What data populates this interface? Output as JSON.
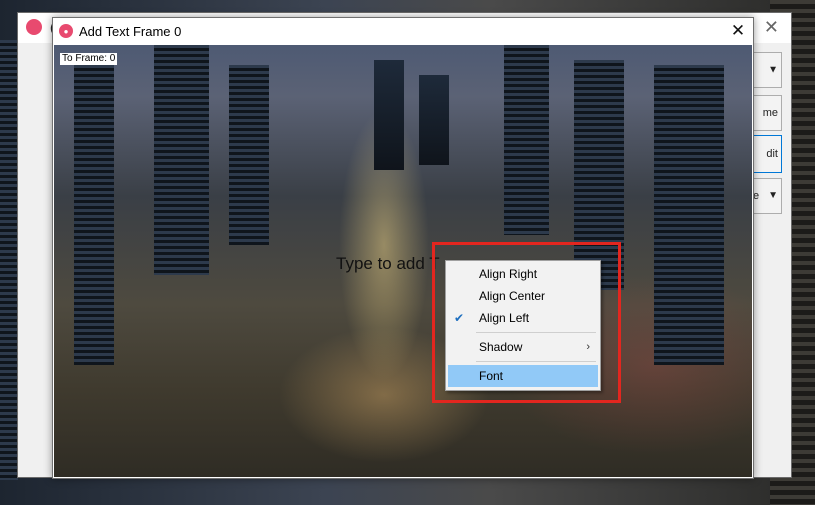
{
  "background_window": {
    "title": "(",
    "side_controls": [
      {
        "label": "",
        "type": "dropdown"
      },
      {
        "label": "me",
        "type": "button"
      },
      {
        "label": "dit",
        "type": "button"
      },
      {
        "label": "e",
        "type": "dropdown"
      }
    ]
  },
  "dialog": {
    "title": "Add Text Frame 0",
    "close_label": "✕",
    "frame_label": "To Frame: 0",
    "overlay_text": "Type to add T"
  },
  "context_menu": {
    "items": [
      {
        "label": "Align Right",
        "checked": false
      },
      {
        "label": "Align Center",
        "checked": false
      },
      {
        "label": "Align Left",
        "checked": true
      },
      {
        "label": "Shadow",
        "submenu": true
      },
      {
        "label": "Font",
        "selected": true
      }
    ]
  },
  "colors": {
    "highlight_border": "#e3261f",
    "menu_selected": "#91c9f7",
    "app_icon": "#e84a6f"
  }
}
